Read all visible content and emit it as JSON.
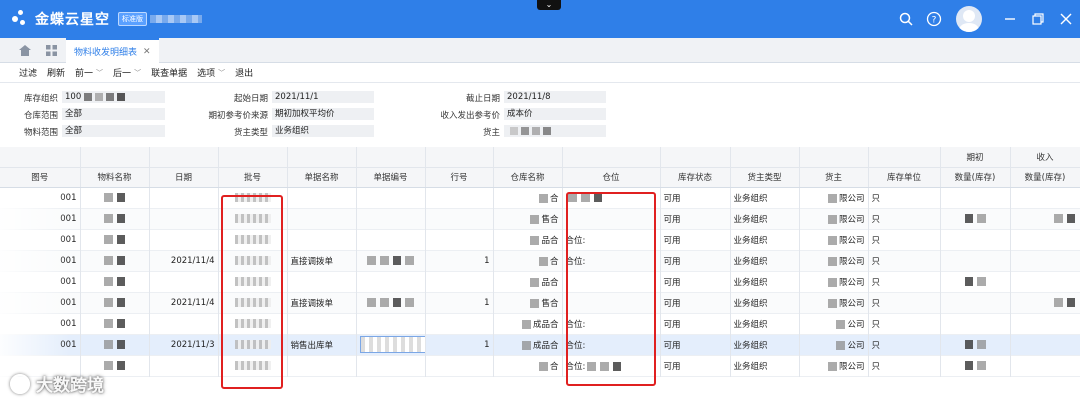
{
  "app": {
    "brand": "金蝶云星空",
    "badge": "标准版"
  },
  "tabs": {
    "active": "物料收发明细表"
  },
  "toolbar": {
    "items": [
      {
        "label": "过滤",
        "dropdown": false
      },
      {
        "label": "刷新",
        "dropdown": false
      },
      {
        "label": "前一",
        "dropdown": true
      },
      {
        "label": "后一",
        "dropdown": true
      },
      {
        "label": "联查单据",
        "dropdown": false
      },
      {
        "label": "选项",
        "dropdown": true
      },
      {
        "label": "退出",
        "dropdown": false
      }
    ]
  },
  "filters": {
    "stock_org": {
      "label": "库存组织",
      "value": "100"
    },
    "warehouse_range": {
      "label": "仓库范围",
      "value": "全部"
    },
    "material_range": {
      "label": "物料范围",
      "value": "全部"
    },
    "start_date": {
      "label": "起始日期",
      "value": "2021/11/1"
    },
    "ref_source": {
      "label": "期初参考价来源",
      "value": "期初加权平均价"
    },
    "owner_type": {
      "label": "货主类型",
      "value": "业务组织"
    },
    "end_date": {
      "label": "截止日期",
      "value": "2021/11/8"
    },
    "ref_price": {
      "label": "收入发出参考价",
      "value": "成本价"
    },
    "owner": {
      "label": "货主",
      "value": ""
    }
  },
  "grid": {
    "group_headers": {
      "opening": "期初",
      "income": "收入"
    },
    "columns": [
      "图号",
      "物料名称",
      "日期",
      "批号",
      "单据名称",
      "单据编号",
      "行号",
      "仓库名称",
      "仓位",
      "库存状态",
      "货主类型",
      "货主",
      "库存单位",
      "数量(库存)",
      "数量(库存)"
    ],
    "rows": [
      {
        "code": "001",
        "date": "",
        "doc": "",
        "line": "",
        "wh": "合",
        "loc": "",
        "status": "可用",
        "otype": "业务组织",
        "owner": "限公司",
        "unit": "只",
        "sel": false
      },
      {
        "code": "001",
        "date": "",
        "doc": "",
        "line": "",
        "wh": "售合",
        "loc": "",
        "status": "可用",
        "otype": "业务组织",
        "owner": "限公司",
        "unit": "只",
        "sel": false
      },
      {
        "code": "001",
        "date": "",
        "doc": "",
        "line": "",
        "wh": "品合",
        "loc": "合位:",
        "status": "可用",
        "otype": "业务组织",
        "owner": "限公司",
        "unit": "只",
        "sel": false
      },
      {
        "code": "001",
        "date": "2021/11/4",
        "doc": "直接调拨单",
        "line": "1",
        "wh": "合",
        "loc": "合位:",
        "status": "可用",
        "otype": "业务组织",
        "owner": "限公司",
        "unit": "只",
        "sel": false
      },
      {
        "code": "001",
        "date": "",
        "doc": "",
        "line": "",
        "wh": "品合",
        "loc": "",
        "status": "可用",
        "otype": "业务组织",
        "owner": "限公司",
        "unit": "只",
        "sel": false
      },
      {
        "code": "001",
        "date": "2021/11/4",
        "doc": "直接调拨单",
        "line": "1",
        "wh": "售合",
        "loc": "",
        "status": "可用",
        "otype": "业务组织",
        "owner": "限公司",
        "unit": "只",
        "sel": false
      },
      {
        "code": "001",
        "date": "",
        "doc": "",
        "line": "",
        "wh": "成品合",
        "loc": "合位:",
        "status": "可用",
        "otype": "业务组织",
        "owner": "公司",
        "unit": "只",
        "sel": false
      },
      {
        "code": "001",
        "date": "2021/11/3",
        "doc": "销售出库单",
        "line": "1",
        "wh": "成品合",
        "loc": "合位:",
        "status": "可用",
        "otype": "业务组织",
        "owner": "公司",
        "unit": "只",
        "sel": true
      },
      {
        "code": "",
        "date": "",
        "doc": "",
        "line": "",
        "wh": "合",
        "loc": "合位:",
        "status": "可用",
        "otype": "业务组织",
        "owner": "限公司",
        "unit": "只",
        "sel": false
      }
    ]
  },
  "watermark": {
    "text": "大数跨境"
  },
  "colors": {
    "primary": "#2f7fe8",
    "highlight": "#e02020"
  }
}
